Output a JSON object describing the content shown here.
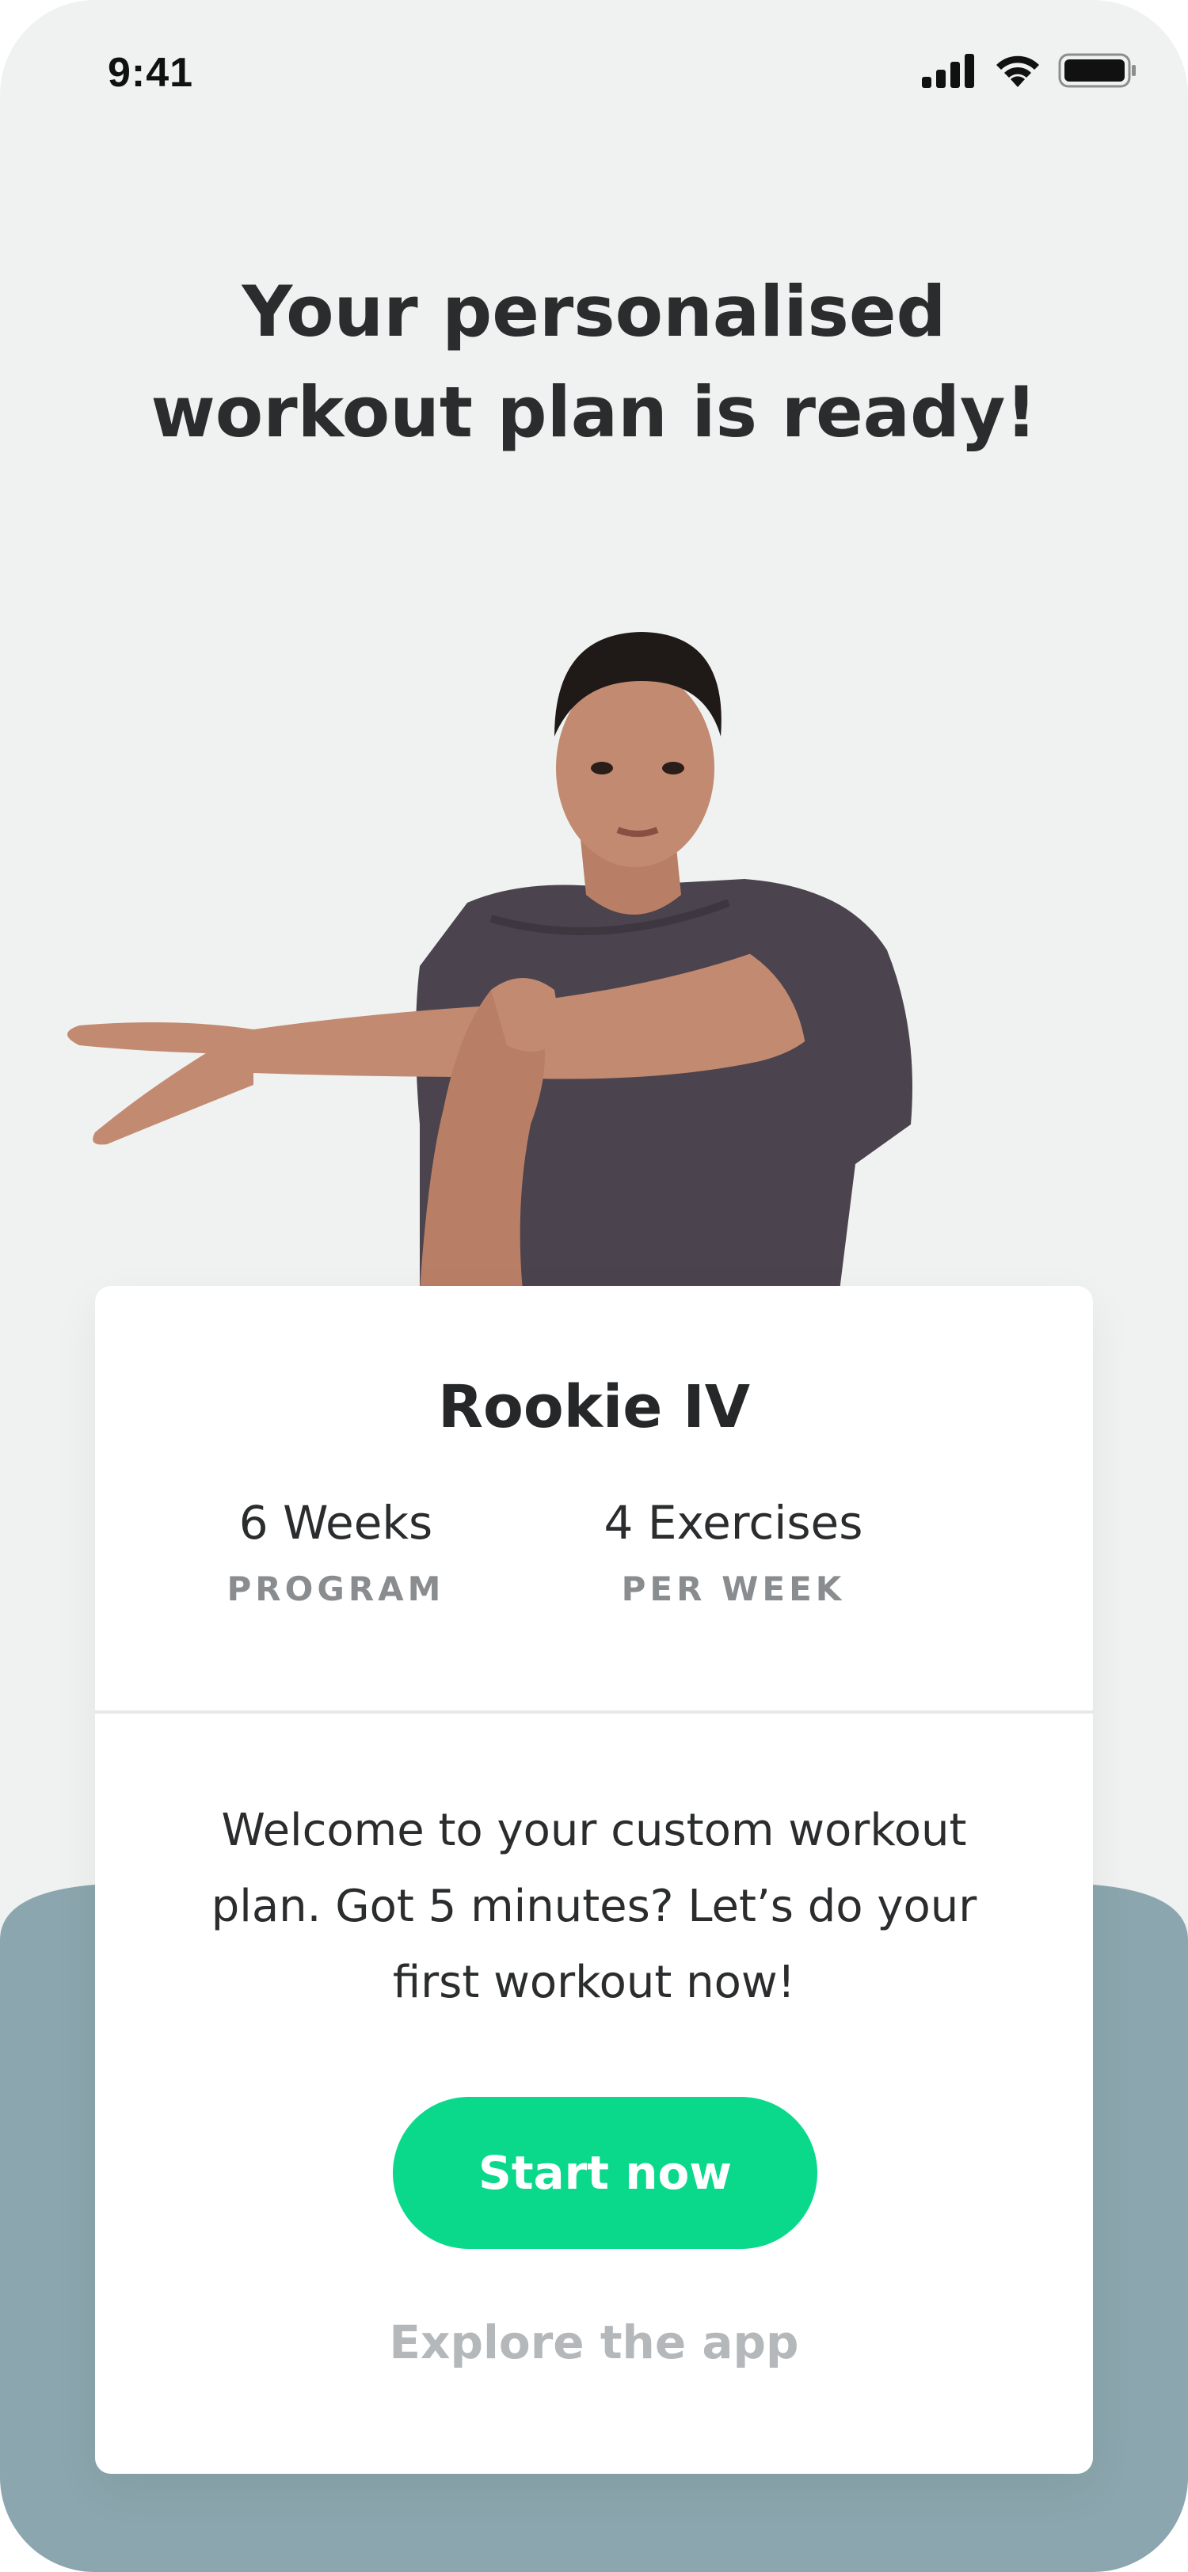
{
  "status_bar": {
    "time": "9:41",
    "icons": [
      "cellular-signal-icon",
      "wifi-icon",
      "battery-icon"
    ]
  },
  "headline": {
    "line1": "Your personalised",
    "line2": "workout plan is ready!"
  },
  "hero": {
    "subject": "man stretching arm"
  },
  "plan": {
    "name": "Rookie IV",
    "stats": [
      {
        "value": "6 Weeks",
        "label": "PROGRAM"
      },
      {
        "value": "4 Exercises",
        "label": "PER WEEK"
      }
    ],
    "description_line1": "Welcome to your custom workout",
    "description_line2": "plan. Got 5 minutes? Let’s do your",
    "description_line3": "first workout now!"
  },
  "actions": {
    "primary_label": "Start now",
    "secondary_label": "Explore the app"
  },
  "colors": {
    "background": "#f0f2f1",
    "accent": "#0ad98c",
    "wave": "#8ba6ae",
    "shirt": "#4b434d",
    "skin": "#c28a70",
    "muted_text": "#8a8d8f"
  }
}
